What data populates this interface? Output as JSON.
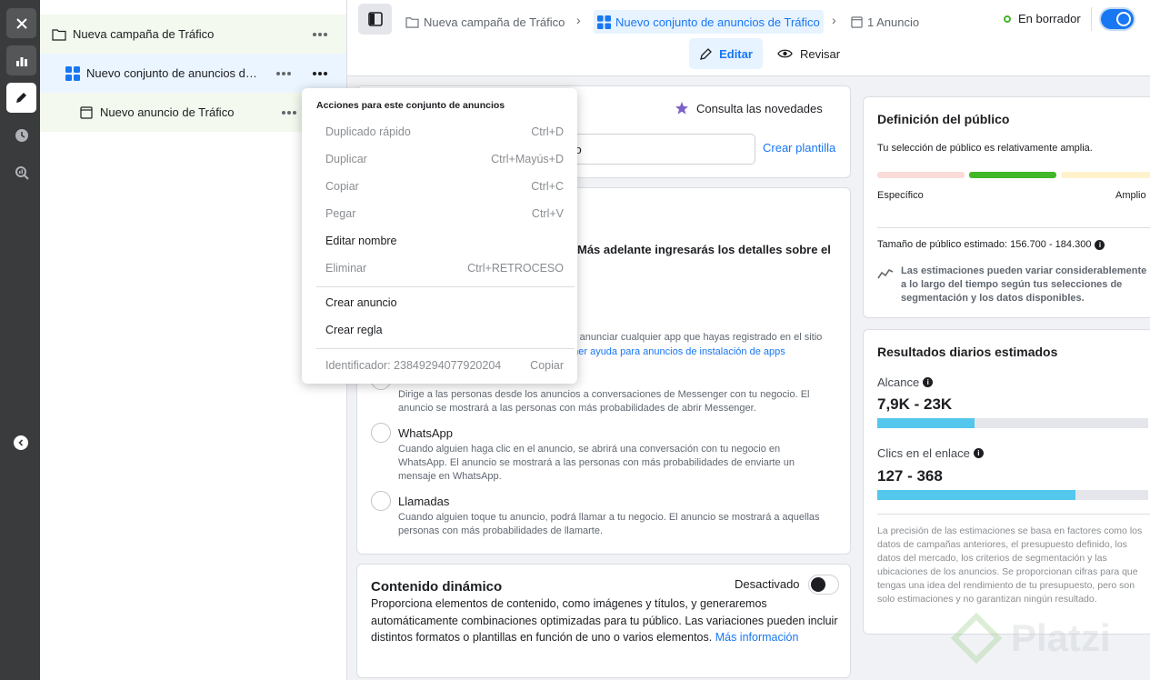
{
  "rail": {
    "icons": [
      "close-icon",
      "bar-chart-icon",
      "pencil-icon",
      "clock-icon",
      "zoom-chart-icon"
    ],
    "collapse_icon": "chevron-left-icon"
  },
  "tree": {
    "campaign": "Nueva campaña de Tráfico",
    "adset": "Nuevo conjunto de anuncios de Tráfico",
    "ad": "Nuevo anuncio de Tráfico"
  },
  "topbar": {
    "crumb_campaign": "Nueva campaña de Tráfico",
    "crumb_adset": "Nuevo conjunto de anuncios de Tráfico",
    "crumb_ad": "1 Anuncio",
    "status": "En borrador",
    "edit_label": "Editar",
    "review_label": "Revisar"
  },
  "menu": {
    "title": "Acciones para este conjunto de anuncios",
    "items": [
      {
        "label": "Duplicado rápido",
        "shortcut": "Ctrl+D"
      },
      {
        "label": "Duplicar",
        "shortcut": "Ctrl+Mayús+D"
      },
      {
        "label": "Copiar",
        "shortcut": "Ctrl+C"
      },
      {
        "label": "Pegar",
        "shortcut": "Ctrl+V"
      },
      {
        "label": "Editar nombre",
        "shortcut": ""
      },
      {
        "label": "Eliminar",
        "shortcut": "Ctrl+RETROCESO"
      },
      {
        "label": "Crear anuncio",
        "shortcut": ""
      },
      {
        "label": "Crear regla",
        "shortcut": ""
      }
    ],
    "identifier": "Identificador: 23849294077920204",
    "copy_label": "Copiar"
  },
  "main": {
    "news_label": "Consulta las novedades",
    "input_partial": "co",
    "create_template": "Crear plantilla",
    "detail_partial": "Más adelante ingresarás los detalles sobre el",
    "app_text_partial": "es anunciar cualquier app que hayas registrado en el sitio",
    "app_link_partial": "ener ayuda para anuncios de instalación de apps",
    "messenger_desc": "Dirige a las personas desde los anuncios a conversaciones de Messenger con tu negocio. El anuncio se mostrará a las personas con más probabilidades de abrir Messenger.",
    "whatsapp_title": "WhatsApp",
    "whatsapp_desc": "Cuando alguien haga clic en el anuncio, se abrirá una conversación con tu negocio en WhatsApp. El anuncio se mostrará a las personas con más probabilidades de enviarte un mensaje en WhatsApp.",
    "calls_title": "Llamadas",
    "calls_desc": "Cuando alguien toque tu anuncio, podrá llamar a tu negocio. El anuncio se mostrará a aquellas personas con más probabilidades de llamarte.",
    "dynamic_title": "Contenido dinámico",
    "dynamic_status": "Desactivado",
    "dynamic_desc": "Proporciona elementos de contenido, como imágenes y títulos, y generaremos automáticamente combinaciones optimizadas para tu público. Las variaciones pueden incluir distintos formatos o plantillas en función de uno o varios elementos.",
    "dynamic_link": "Más información"
  },
  "audience": {
    "title": "Definición del público",
    "subtitle": "Tu selección de público es relativamente amplia.",
    "specific": "Específico",
    "broad": "Amplio",
    "size_label": "Tamaño de público estimado: 156.700 - 184.300",
    "note": "Las estimaciones pueden variar considerablemente a lo largo del tiempo según tus selecciones de segmentación y los datos disponibles.",
    "colors": {
      "specific": "#fadbd8",
      "mid": "#42b72a",
      "broad": "#fff2cc"
    }
  },
  "results": {
    "title": "Resultados diarios estimados",
    "reach_label": "Alcance",
    "reach_value": "7,9K - 23K",
    "reach_fill": 0.36,
    "clicks_label": "Clics en el enlace",
    "clicks_value": "127 - 368",
    "clicks_fill": 0.73,
    "note": "La precisión de las estimaciones se basa en factores como los datos de campañas anteriores, el presupuesto definido, los datos del mercado, los criterios de segmentación y las ubicaciones de los anuncios. Se proporcionan cifras para que tengas una idea del rendimiento de tu presupuesto, pero son solo estimaciones y no garantizan ningún resultado."
  },
  "watermark": "Platzi",
  "colors": {
    "accent": "#1877f2",
    "status_green": "#42b72a"
  }
}
